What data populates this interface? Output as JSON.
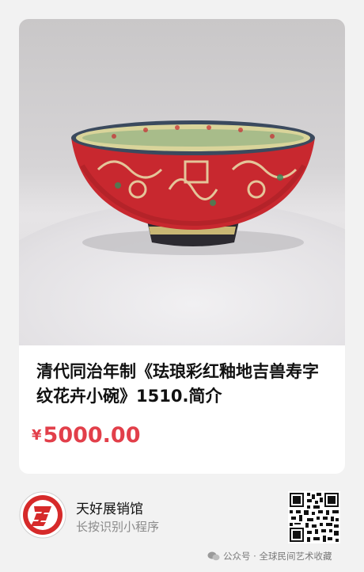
{
  "product": {
    "title": "清代同治年制《珐琅彩红釉地吉兽寿字纹花卉小碗》1510.简介",
    "currency_symbol": "¥",
    "price": "5000.00",
    "image_icon": "porcelain-bowl-photo"
  },
  "mini_program": {
    "name": "天好展销馆",
    "hint": "长按识别小程序",
    "logo_icon": "red-circle-3-logo",
    "qr_icon": "qr-code-icon"
  },
  "watermark": {
    "text": "公众号 · 全球民间艺术收藏",
    "icon": "wechat-icon"
  },
  "colors": {
    "background": "#f2f2f2",
    "card": "#ffffff",
    "price": "#e23f4a",
    "logo_red": "#d62a2a"
  }
}
